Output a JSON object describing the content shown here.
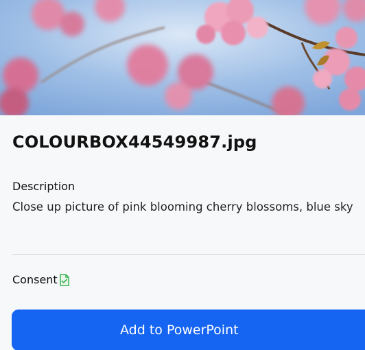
{
  "image": {
    "filename": "COLOURBOX44549987.jpg",
    "description_label": "Description",
    "description_text": "Close up picture of pink blooming cherry blossoms, blue sky",
    "consent_label": "Consent",
    "consent_icon": "consent-document-check-icon"
  },
  "actions": {
    "add_label": "Add to PowerPoint"
  },
  "colors": {
    "button": "#1565f2",
    "background": "#f7f8fa",
    "consent_icon": "#37b24d"
  }
}
